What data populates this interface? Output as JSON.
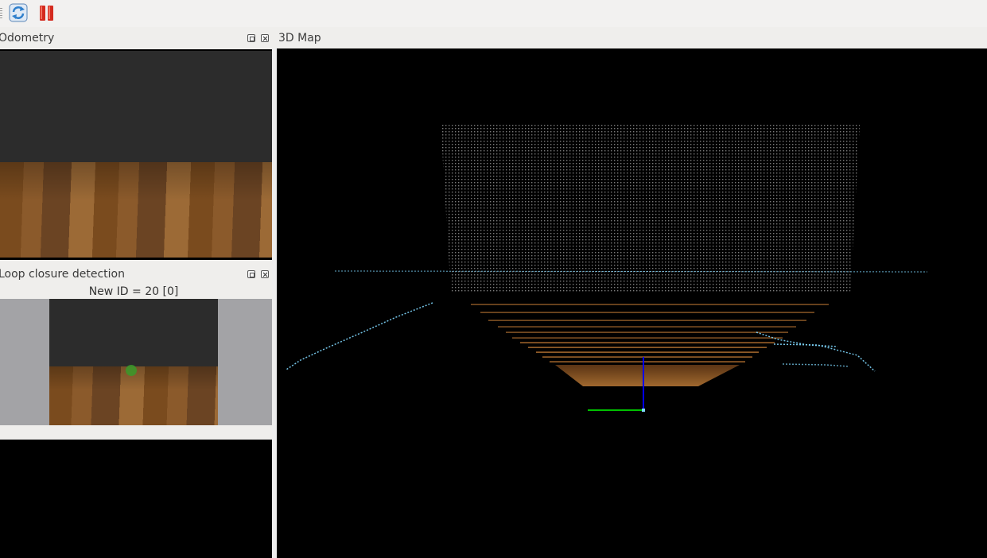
{
  "toolbar": {
    "buttons": [
      {
        "name": "refresh",
        "icon": "refresh-icon"
      },
      {
        "name": "pause",
        "icon": "pause-icon"
      }
    ]
  },
  "panels": {
    "odometry": {
      "title": "Odometry"
    },
    "loop_closure": {
      "title": "Loop closure detection",
      "status": "New ID = 20 [0]"
    },
    "map3d": {
      "title": "3D Map"
    }
  },
  "colors": {
    "background": "#efeeec",
    "accent_blue": "#2f7fcc",
    "pause_red": "#d42a1e",
    "floor_brown": "#8b5a2b",
    "sky_dark": "#2c2c2c",
    "map_bg": "#000000",
    "wall_points": "#9a9a9a",
    "scan_cyan": "#7fd8ff",
    "axis_x": "#00c000",
    "axis_z": "#0000ff"
  }
}
